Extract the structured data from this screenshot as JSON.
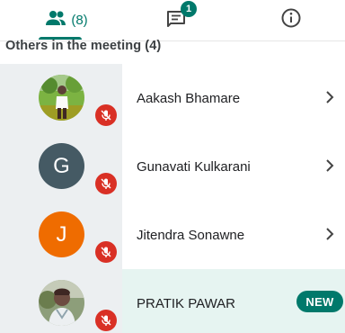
{
  "tabs": {
    "people": {
      "icon": "people-icon",
      "count_label": "(8)"
    },
    "chat": {
      "icon": "chat-icon",
      "badge": "1"
    },
    "info": {
      "icon": "info-icon"
    },
    "active": "people"
  },
  "section": {
    "heading": "Others in the meeting (4)"
  },
  "participants": [
    {
      "name": "Aakash Bhamare",
      "avatar": "photo",
      "muted": true,
      "action": "chevron-right-icon"
    },
    {
      "name": "Gunavati Kulkarani",
      "avatar": "letter",
      "initial": "G",
      "avatar_color": "#455a64",
      "muted": true,
      "action": "chevron-right-icon"
    },
    {
      "name": "Jitendra Sonawne",
      "avatar": "letter",
      "initial": "J",
      "avatar_color": "#ef6c00",
      "muted": true,
      "action": "chevron-right-icon"
    },
    {
      "name": "PRATIK PAWAR",
      "avatar": "photo",
      "muted": true,
      "badge": "NEW",
      "highlighted": true
    }
  ],
  "colors": {
    "accent": "#00796b",
    "muted_mic": "#d93025",
    "highlight": "#e6f4f1",
    "avatar_column": "#eceff1"
  }
}
